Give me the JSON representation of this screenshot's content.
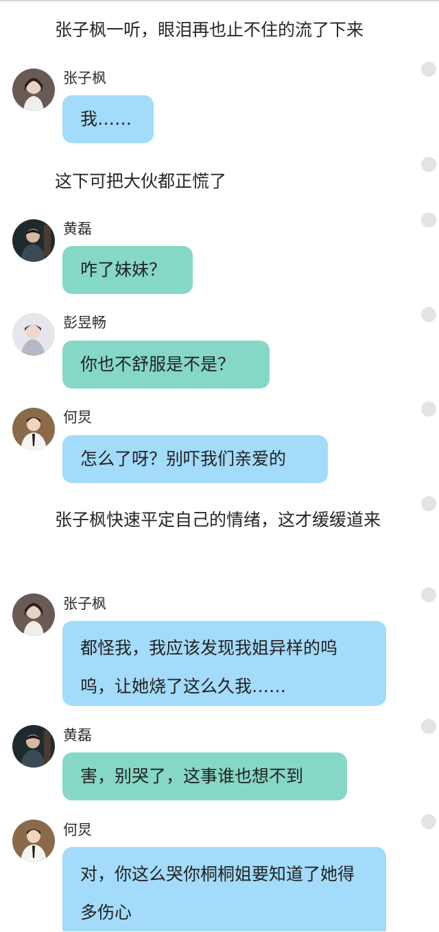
{
  "colors": {
    "bubble_blue": "#a3dbfa",
    "bubble_green": "#86d8c6",
    "rail_dot": "#e3e3e3"
  },
  "story": {
    "narration_1": "张子枫一听，眼泪再也止不住的流了下来",
    "narration_2": "这下可把大伙都正慌了",
    "narration_3": "张子枫快速平定自己的情绪，这才缓缓道来",
    "messages": [
      {
        "speaker": "张子枫",
        "text": "我……",
        "bubble_color": "blue",
        "avatar": "zhang-zifeng-avatar"
      },
      {
        "speaker": "黄磊",
        "text": "咋了妹妹？",
        "bubble_color": "green",
        "avatar": "huang-lei-avatar"
      },
      {
        "speaker": "彭昱畅",
        "text": "你也不舒服是不是？",
        "bubble_color": "green",
        "avatar": "peng-yuchang-avatar"
      },
      {
        "speaker": "何炅",
        "text": "怎么了呀？别吓我们亲爱的",
        "bubble_color": "blue",
        "avatar": "he-jiong-avatar"
      },
      {
        "speaker": "张子枫",
        "text": "都怪我，我应该发现我姐异样的呜呜，让她烧了这么久我……",
        "bubble_color": "blue",
        "avatar": "zhang-zifeng-avatar"
      },
      {
        "speaker": "黄磊",
        "text": "害，别哭了，这事谁也想不到",
        "bubble_color": "green",
        "avatar": "huang-lei-avatar"
      },
      {
        "speaker": "何炅",
        "text": "对，你这么哭你桐桐姐要知道了她得多伤心",
        "bubble_color": "blue",
        "avatar": "he-jiong-avatar"
      }
    ]
  }
}
